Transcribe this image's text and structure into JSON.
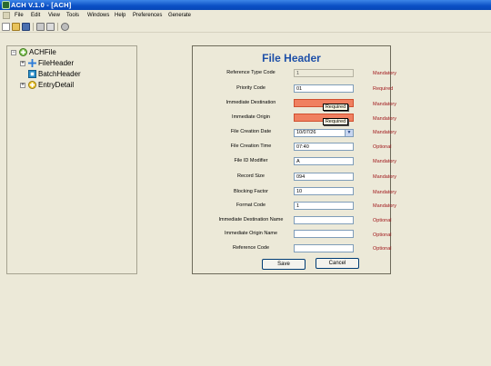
{
  "window": {
    "title": "ACH V.1.0 - [ACH]"
  },
  "menu": [
    "File",
    "Edit",
    "View",
    "Tools",
    "Windows",
    "Help",
    "Preferences",
    "Generate"
  ],
  "toolbar": {
    "icons": [
      "new-file-icon",
      "open-folder-icon",
      "save-icon",
      "print-icon",
      "print-preview-icon",
      "settings-icon"
    ]
  },
  "tree": {
    "root": "ACHFile",
    "children": [
      "FileHeader",
      "BatchHeader",
      "EntryDetail"
    ]
  },
  "form": {
    "title": "File Header",
    "fields": [
      {
        "label": "Reference Type Code",
        "value": "1",
        "status": "Mandatory"
      },
      {
        "label": "Priority Code",
        "value": "01",
        "status": "Required"
      },
      {
        "label": "Immediate Destination",
        "value": "",
        "status": "Mandatory",
        "tooltip": "Required"
      },
      {
        "label": "Immediate Origin",
        "value": "",
        "status": "Mandatory",
        "tooltip": "Required"
      },
      {
        "label": "File Creation Date",
        "value": "10/07/26",
        "status": "Mandatory"
      },
      {
        "label": "File Creation Time",
        "value": "07:40",
        "status": "Optional"
      },
      {
        "label": "File ID Modifier",
        "value": "A",
        "status": "Mandatory"
      },
      {
        "label": "Record Size",
        "value": "094",
        "status": "Mandatory"
      },
      {
        "label": "Blocking Factor",
        "value": "10",
        "status": "Mandatory"
      },
      {
        "label": "Format Code",
        "value": "1",
        "status": "Mandatory"
      },
      {
        "label": "Immediate Destination Name",
        "value": "",
        "status": "Optional"
      },
      {
        "label": "Immediate Origin Name",
        "value": "",
        "status": "Optional"
      },
      {
        "label": "Reference Code",
        "value": "",
        "status": "Optional"
      }
    ],
    "save_label": "Save",
    "cancel_label": "Cancel"
  },
  "colors": {
    "title_blue": "#1e50a8",
    "status_red": "#a0181c",
    "error_fill": "#f08060"
  }
}
